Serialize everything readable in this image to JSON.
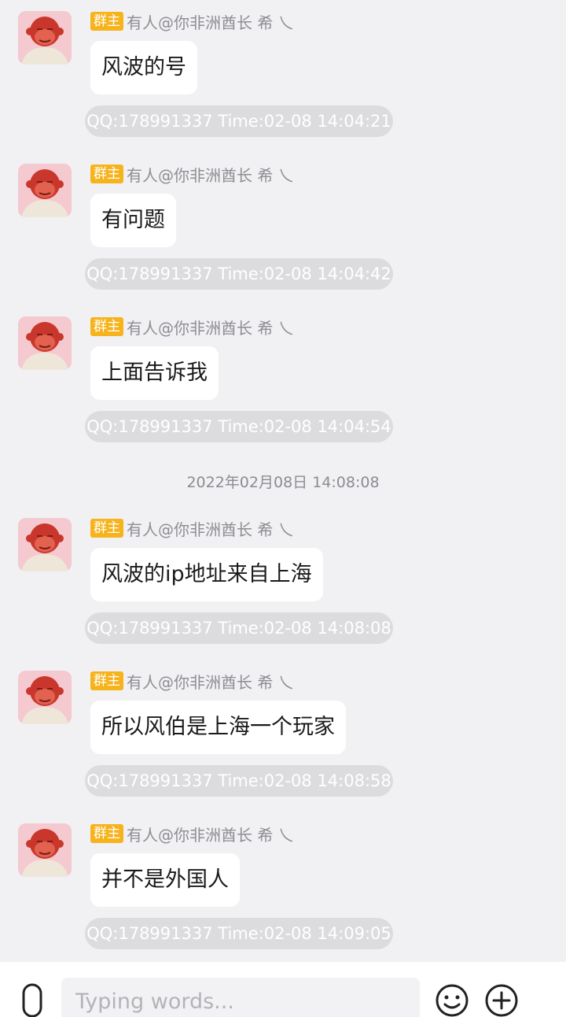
{
  "messages": [
    {
      "badge": "群主",
      "sender": "有人@你非洲酋长 希 乀",
      "text": "风波的号",
      "meta": "QQ:178991337  Time:02-08 14:04:21"
    },
    {
      "badge": "群主",
      "sender": "有人@你非洲酋长 希 乀",
      "text": "有问题",
      "meta": "QQ:178991337  Time:02-08 14:04:42"
    },
    {
      "badge": "群主",
      "sender": "有人@你非洲酋长 希 乀",
      "text": "上面告诉我",
      "meta": "QQ:178991337  Time:02-08 14:04:54"
    },
    {
      "badge": "群主",
      "sender": "有人@你非洲酋长 希 乀",
      "text": "风波的ip地址来自上海",
      "meta": "QQ:178991337  Time:02-08 14:08:08"
    },
    {
      "badge": "群主",
      "sender": "有人@你非洲酋长 希 乀",
      "text": "所以风伯是上海一个玩家",
      "meta": "QQ:178991337  Time:02-08 14:08:58"
    },
    {
      "badge": "群主",
      "sender": "有人@你非洲酋长 希 乀",
      "text": "并不是外国人",
      "meta": "QQ:178991337  Time:02-08 14:09:05"
    }
  ],
  "date_divider": "2022年02月08日 14:08:08",
  "input": {
    "placeholder": "Typing words..."
  },
  "icons": {
    "mic": "microphone-icon",
    "emoji": "smiley-icon",
    "plus": "plus-circle-icon"
  },
  "colors": {
    "background": "#f1f1f4",
    "badge": "#f6b31c",
    "bubble": "#ffffff",
    "meta_pill": "#dcdcdf"
  }
}
